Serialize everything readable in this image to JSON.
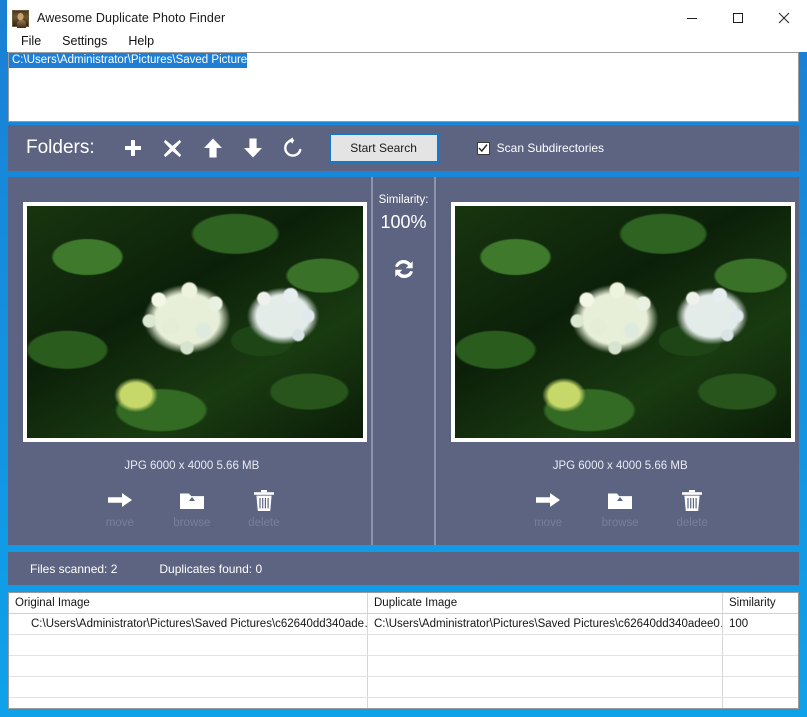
{
  "window": {
    "title": "Awesome Duplicate Photo Finder",
    "app_icon": "portrait-painting-icon",
    "minimize": "minimize-icon",
    "maximize": "maximize-icon",
    "close": "close-icon"
  },
  "menu": {
    "items": [
      {
        "label": "File"
      },
      {
        "label": "Settings"
      },
      {
        "label": "Help"
      }
    ]
  },
  "folder_list": {
    "rows": [
      {
        "path": "C:\\Users\\Administrator\\Pictures\\Saved Pictures\\",
        "selected": true
      }
    ]
  },
  "toolbar": {
    "label": "Folders:",
    "buttons": [
      {
        "name": "add-folder-icon",
        "glyph": "plus"
      },
      {
        "name": "remove-folder-icon",
        "glyph": "cross"
      },
      {
        "name": "move-up-icon",
        "glyph": "arrow-up"
      },
      {
        "name": "move-down-icon",
        "glyph": "arrow-down"
      },
      {
        "name": "reset-icon",
        "glyph": "refresh"
      }
    ],
    "start_search": "Start Search",
    "scan_subdirectories": {
      "label": "Scan Subdirectories",
      "checked": true
    }
  },
  "compare": {
    "similarity_label": "Similarity:",
    "similarity_value": "100%",
    "swap_icon": "swap-images-icon",
    "panes": [
      {
        "side": "left",
        "meta": "JPG  6000 x 4000  5.66 MB",
        "actions": [
          {
            "name": "move-icon",
            "label": "move"
          },
          {
            "name": "browse-icon",
            "label": "browse"
          },
          {
            "name": "delete-icon",
            "label": "delete"
          }
        ]
      },
      {
        "side": "right",
        "meta": "JPG  6000 x 4000  5.66 MB",
        "actions": [
          {
            "name": "move-icon",
            "label": "move"
          },
          {
            "name": "browse-icon",
            "label": "browse"
          },
          {
            "name": "delete-icon",
            "label": "delete"
          }
        ]
      }
    ]
  },
  "status": {
    "files_scanned": "Files scanned: 2",
    "duplicates_found": "Duplicates found: 0"
  },
  "results": {
    "headers": {
      "original": "Original Image",
      "duplicate": "Duplicate Image",
      "similarity": "Similarity"
    },
    "rows": [
      {
        "original": "C:\\Users\\Administrator\\Pictures\\Saved Pictures\\c62640dd340ade…",
        "duplicate": "C:\\Users\\Administrator\\Pictures\\Saved Pictures\\c62640dd340adee0…",
        "similarity": "100"
      },
      {
        "original": "",
        "duplicate": "",
        "similarity": ""
      },
      {
        "original": "",
        "duplicate": "",
        "similarity": ""
      },
      {
        "original": "",
        "duplicate": "",
        "similarity": ""
      },
      {
        "original": "",
        "duplicate": "",
        "similarity": ""
      }
    ]
  },
  "colors": {
    "window_border": "#1490df",
    "panel": "#5d6482",
    "selection": "#1f7fd6",
    "button_focus": "#1878c8",
    "dim_label": "#767f9e"
  }
}
